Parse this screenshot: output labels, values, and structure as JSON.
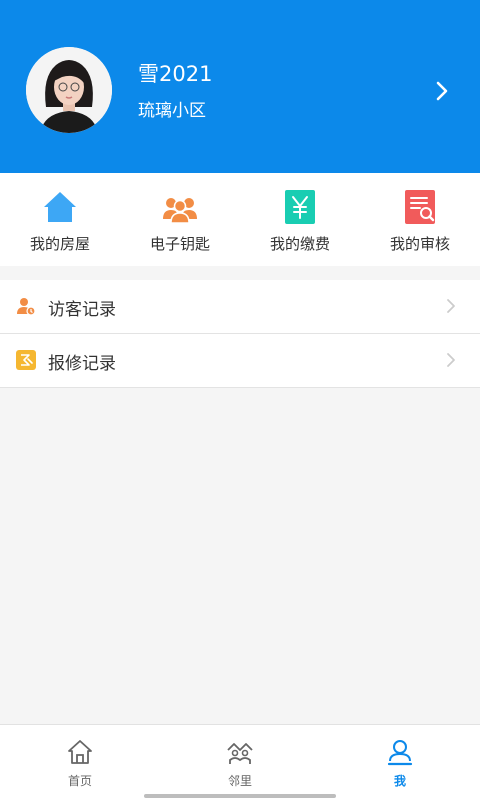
{
  "profile": {
    "name": "雪2021",
    "community": "琉璃小区",
    "avatar_icon": "avatar-photo",
    "chevron_icon": "chevron-right-icon"
  },
  "quick_actions": [
    {
      "label": "我的房屋",
      "icon": "house-icon",
      "color": "#3da7f5"
    },
    {
      "label": "电子钥匙",
      "icon": "people-icon",
      "color": "#f28d45"
    },
    {
      "label": "我的缴费",
      "icon": "yuan-icon",
      "color": "#19cdb2"
    },
    {
      "label": "我的审核",
      "icon": "document-search-icon",
      "color": "#f15b5b"
    }
  ],
  "records": [
    {
      "label": "访客记录",
      "icon": "visitor-icon",
      "color": "#f28d45"
    },
    {
      "label": "报修记录",
      "icon": "repair-icon",
      "color": "#f5b731"
    }
  ],
  "tabs": [
    {
      "label": "首页",
      "icon": "home-tab-icon",
      "active": false
    },
    {
      "label": "邻里",
      "icon": "neighbors-tab-icon",
      "active": false
    },
    {
      "label": "我",
      "icon": "me-tab-icon",
      "active": true
    }
  ],
  "colors": {
    "header_bg": "#0c89ea",
    "active_tab": "#0c89ea",
    "page_bg": "#f5f5f5"
  }
}
